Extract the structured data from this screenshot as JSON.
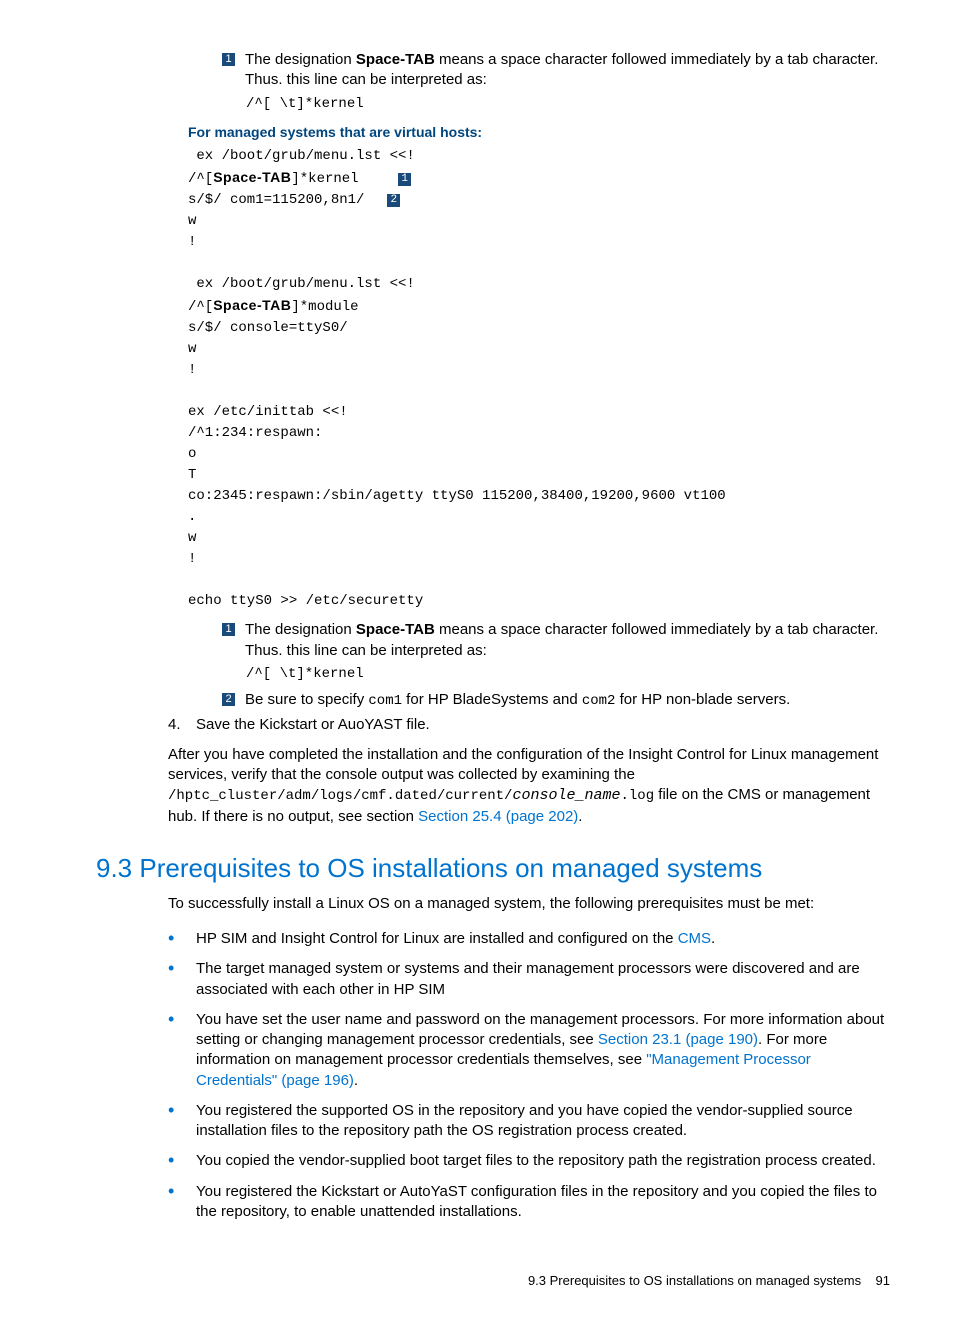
{
  "callout1a_pre": "The designation ",
  "callout1a_bold": "Space-TAB",
  "callout1a_post": " means a space character followed immediately by a tab character. Thus. this line can be interpreted as:",
  "callout1a_code": "/^[ \\t]*kernel",
  "subhead1": "For managed systems that are virtual hosts:",
  "code": {
    "l1": " ex /boot/grub/menu.lst <<!",
    "l2a": "/^[",
    "l2b": "Space-TAB",
    "l2c": "]*kernel",
    "l3": "s/$/ com1=115200,8n1/",
    "l4": "w",
    "l5": "!",
    "l6": " ex /boot/grub/menu.lst <<!",
    "l7a": "/^[",
    "l7b": "Space-TAB",
    "l7c": "]*module",
    "l8": "s/$/ console=ttyS0/",
    "l9": "w",
    "l10": "!",
    "l11": "ex /etc/inittab <<!",
    "l12": "/^1:234:respawn:",
    "l13": "o",
    "l14": "T",
    "l15": "co:2345:respawn:/sbin/agetty ttyS0 115200,38400,19200,9600 vt100",
    "l16": ".",
    "l17": "w",
    "l18": "!",
    "l19": "echo ttyS0 >> /etc/securetty"
  },
  "callout1b_pre": "The designation ",
  "callout1b_bold": "Space-TAB",
  "callout1b_post": " means a space character followed immediately by a tab character. Thus. this line can be interpreted as:",
  "callout1b_code": "/^[ \\t]*kernel",
  "callout2_pre": "Be sure to specify ",
  "callout2_m1": "com1",
  "callout2_mid": " for HP BladeSystems and ",
  "callout2_m2": "com2",
  "callout2_post": " for HP non-blade servers.",
  "step4_num": "4.",
  "step4_text": "Save the Kickstart or AuoYAST file.",
  "para1a": "After you have completed the installation and the configuration of the Insight Control for Linux management services, verify that the console output was collected by examining the ",
  "para1_path1": "/hptc_cluster/adm/logs/cmf.dated/current/",
  "para1_path2": "console_name",
  "para1_path3": ".log",
  "para1b": " file on the CMS or management hub. If there is no output, see section ",
  "para1_link": "Section 25.4 (page 202)",
  "para1c": ".",
  "section_title": "9.3 Prerequisites to OS installations on managed systems",
  "intro": "To successfully install a Linux OS on a managed system, the following prerequisites must be met:",
  "b1a": "HP SIM and Insight Control for Linux are installed and configured on the ",
  "b1_link": "CMS",
  "b1b": ".",
  "b2": "The target managed system or systems and their management processors were discovered and are associated with each other in HP SIM",
  "b3a": "You have set the user name and password on the management processors. For more information about setting or changing management processor credentials, see ",
  "b3_link1": "Section 23.1 (page 190)",
  "b3b": ". For more information on management processor credentials themselves, see ",
  "b3_link2": "\"Management Processor Credentials\" (page 196)",
  "b3c": ".",
  "b4": "You registered the supported OS in the repository and you have copied the vendor-supplied source installation files to the repository path the OS registration process created.",
  "b5": "You copied the vendor-supplied boot target files to the repository path the registration process created.",
  "b6": "You registered the Kickstart or AutoYaST configuration files in the repository and you copied the files to the repository, to enable unattended installations.",
  "footer_text": "9.3 Prerequisites to OS installations on managed systems",
  "footer_page": "91",
  "num1": "1",
  "num2": "2"
}
